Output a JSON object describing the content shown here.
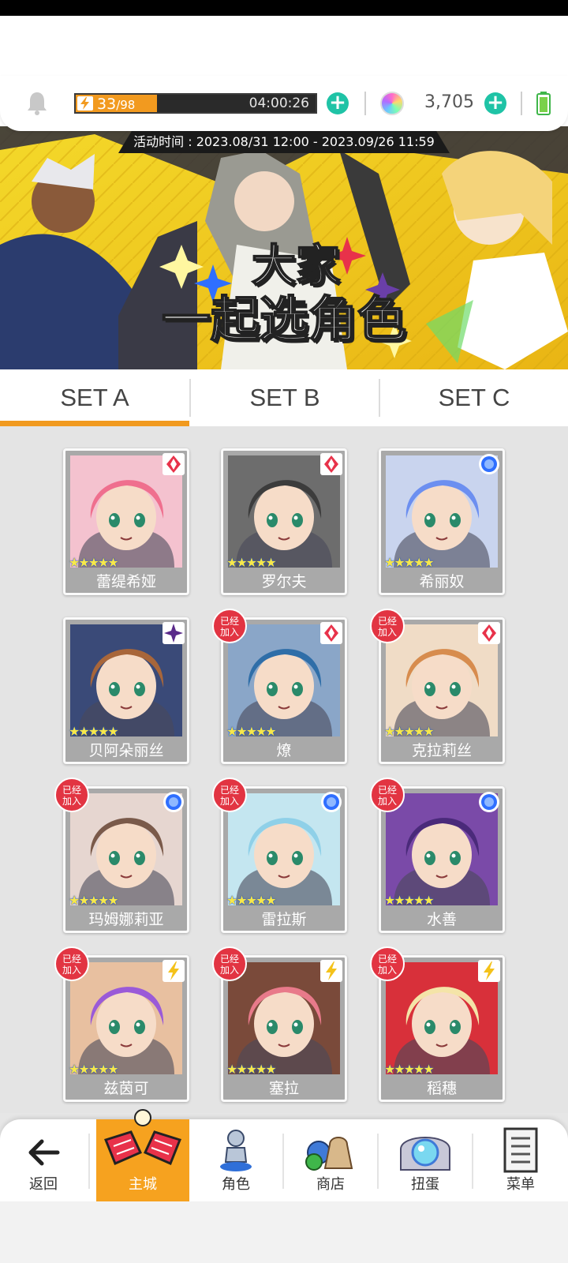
{
  "resources": {
    "stamina_current": "33",
    "stamina_max": "/98",
    "stamina_fraction": 0.34,
    "stamina_timer": "04:00:26",
    "gem_count": "3,705"
  },
  "banner": {
    "event_time": "活动时间 : 2023.08/31 12:00 - 2023.09/26 11:59",
    "title_line1": "大家",
    "title_line2": "一起选角色"
  },
  "tabs": [
    {
      "label": "SET A",
      "active": true
    },
    {
      "label": "SET B",
      "active": false
    },
    {
      "label": "SET C",
      "active": false
    }
  ],
  "joined_label": [
    "已经",
    "加入"
  ],
  "characters": [
    {
      "name": "蕾缇希娅",
      "attribute": "red-diamond",
      "joined": false,
      "hair": "#ef6f8e",
      "bg": "#f4c2cf"
    },
    {
      "name": "罗尔夫",
      "attribute": "red-diamond",
      "joined": false,
      "hair": "#3c3c3c",
      "bg": "#6d6d6d"
    },
    {
      "name": "希丽奴",
      "attribute": "blue-circle",
      "joined": false,
      "hair": "#6c8ff0",
      "bg": "#c9d4ee"
    },
    {
      "name": "贝阿朵丽丝",
      "attribute": "dark-star",
      "joined": false,
      "hair": "#a8663a",
      "bg": "#3a4a78"
    },
    {
      "name": "燎",
      "attribute": "red-diamond",
      "joined": true,
      "hair": "#2f6ea8",
      "bg": "#8aa6c8"
    },
    {
      "name": "克拉莉丝",
      "attribute": "red-diamond",
      "joined": true,
      "hair": "#d78c4e",
      "bg": "#f0dcc6"
    },
    {
      "name": "玛姆娜莉亚",
      "attribute": "blue-circle",
      "joined": true,
      "hair": "#7a5a4a",
      "bg": "#e6d6d0"
    },
    {
      "name": "雷拉斯",
      "attribute": "blue-circle",
      "joined": true,
      "hair": "#8fd0e8",
      "bg": "#c4e6f0"
    },
    {
      "name": "水善",
      "attribute": "blue-circle",
      "joined": true,
      "hair": "#4a2a7a",
      "bg": "#7a4aa8"
    },
    {
      "name": "兹茵可",
      "attribute": "yellow-bolt",
      "joined": true,
      "hair": "#9a5ad8",
      "bg": "#e8c0a0"
    },
    {
      "name": "塞拉",
      "attribute": "yellow-bolt",
      "joined": true,
      "hair": "#e87a8a",
      "bg": "#7a4a3a"
    },
    {
      "name": "稻穗",
      "attribute": "yellow-bolt",
      "joined": true,
      "hair": "#f4e4a8",
      "bg": "#d8303a"
    }
  ],
  "nav": [
    {
      "label": "返回",
      "icon": "back-arrow-icon",
      "active": false
    },
    {
      "label": "主城",
      "icon": "castle-wings-icon",
      "active": true
    },
    {
      "label": "角色",
      "icon": "character-figure-icon",
      "active": false
    },
    {
      "label": "商店",
      "icon": "shop-bag-icon",
      "active": false
    },
    {
      "label": "扭蛋",
      "icon": "gacha-crystal-icon",
      "active": false
    },
    {
      "label": "菜单",
      "icon": "menu-list-icon",
      "active": false
    }
  ],
  "colors": {
    "accent_orange": "#f29a1f",
    "plus_teal": "#1fc3a6",
    "joined_red": "#e23442",
    "card_gray": "#a9a9a9"
  }
}
